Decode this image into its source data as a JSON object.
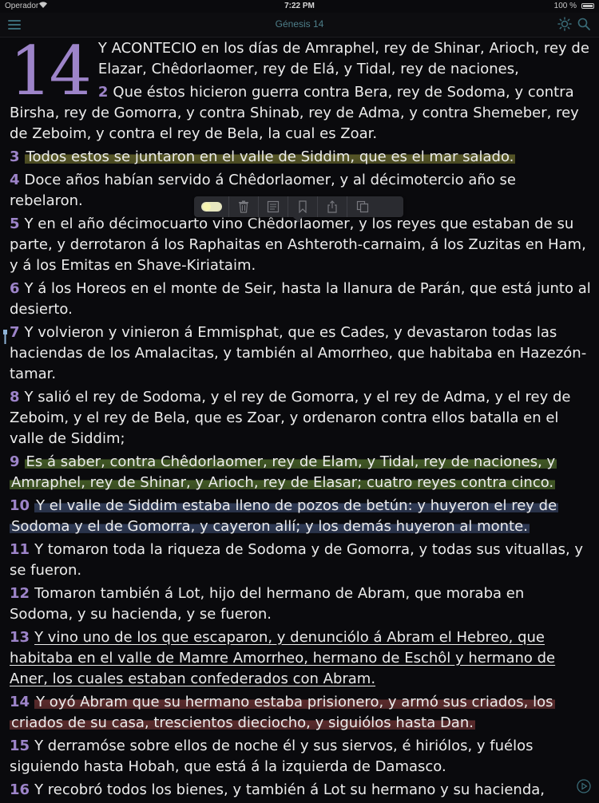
{
  "status_bar": {
    "carrier": "Operador",
    "time": "7:22 PM",
    "battery": "100 %"
  },
  "nav": {
    "title": "Génesis 14",
    "icons": [
      "menu-icon",
      "brightness-icon",
      "search-icon"
    ]
  },
  "reader": {
    "chapter": "14",
    "verses": [
      {
        "num": "",
        "text": "Y ACONTECIO en los días de Amraphel, rey de Shinar, Arioch, rey de Elazar, Chêdorlaomer, rey de Elá, y Tidal, rey de naciones,",
        "highlight": "none"
      },
      {
        "num": "2",
        "text": "Que éstos hicieron guerra contra Bera, rey de Sodoma, y contra Birsha, rey de Gomorra, y contra Shinab, rey de Adma, y contra Shemeber, rey de Zeboim, y contra el rey de Bela, la cual es Zoar.",
        "highlight": "none"
      },
      {
        "num": "3",
        "text": "Todos estos se juntaron en el valle de Siddim, que es el mar salado.",
        "highlight": "yellow"
      },
      {
        "num": "4",
        "text": "Doce años habían servido á Chêdorlaomer, y al décimotercio año se rebelaron.",
        "highlight": "none"
      },
      {
        "num": "5",
        "text": "Y en el año décimocuarto vino Chêdorlaomer, y los reyes que estaban de su parte, y derrotaron á los Raphaitas en Ashteroth-carnaim, á los Zuzitas en Ham, y á los Emitas en Shave-Kiriataim.",
        "highlight": "none"
      },
      {
        "num": "6",
        "text": "Y á los Horeos en el monte de Seir, hasta la llanura de Parán, que está junto al desierto.",
        "highlight": "none"
      },
      {
        "num": "7",
        "text": "Y volvieron y vinieron á Emmisphat, que es Cades, y devastaron todas las haciendas de los Amalacitas, y también al Amorrheo, que habitaba en Hazezón-tamar.",
        "highlight": "none"
      },
      {
        "num": "8",
        "text": "Y salió el rey de Sodoma, y el rey de Gomorra, y el rey de Adma, y el rey de Zeboim, y el rey de Bela, que es Zoar, y ordenaron contra ellos batalla en el valle de Siddim;",
        "highlight": "none"
      },
      {
        "num": "9",
        "text": "Es á saber, contra Chêdorlaomer, rey de Elam, y Tidal, rey de naciones, y Amraphel, rey de Shinar, y Arioch, rey de Elasar; cuatro reyes contra cinco.",
        "highlight": "green"
      },
      {
        "num": "10",
        "text": "Y el valle de Siddim estaba lleno de pozos de betún: y huyeron el rey de Sodoma y el de Gomorra, y cayeron allí; y los demás huyeron al monte.",
        "highlight": "blue"
      },
      {
        "num": "11",
        "text": "Y tomaron toda la riqueza de Sodoma y de Gomorra, y todas sus vituallas, y se fueron.",
        "highlight": "none"
      },
      {
        "num": "12",
        "text": "Tomaron también á Lot, hijo del hermano de Abram, que moraba en Sodoma, y su hacienda, y se fueron.",
        "highlight": "none"
      },
      {
        "num": "13",
        "text": "Y vino uno de los que escaparon, y denunciólo á Abram el Hebreo, que habitaba en el valle de Mamre Amorrheo, hermano de Eschôl y hermano de Aner, los cuales estaban confederados con Abram.",
        "highlight": "underline"
      },
      {
        "num": "14",
        "text": "Y oyó Abram que su hermano estaba prisionero, y armó sus criados, los criados de su casa, trescientos dieciocho, y siguiólos hasta Dan.",
        "highlight": "red"
      },
      {
        "num": "15",
        "text": "Y derramóse sobre ellos de noche él y sus siervos, é hiriólos, y fuélos siguiendo hasta Hobah, que está á la izquierda de Damasco.",
        "highlight": "none"
      },
      {
        "num": "16",
        "text": "Y recobró todos los bienes, y también á Lot su hermano y su hacienda,",
        "highlight": "none"
      }
    ]
  },
  "popup_toolbar": {
    "items": [
      "highlight-color-icon",
      "trash-icon",
      "note-icon",
      "bookmark-icon",
      "share-icon",
      "copy-icon"
    ]
  },
  "colors": {
    "verse_number": "#9d84c9",
    "nav_accent": "#3a6c78",
    "background": "#0a0a0d",
    "text": "#ececec"
  }
}
